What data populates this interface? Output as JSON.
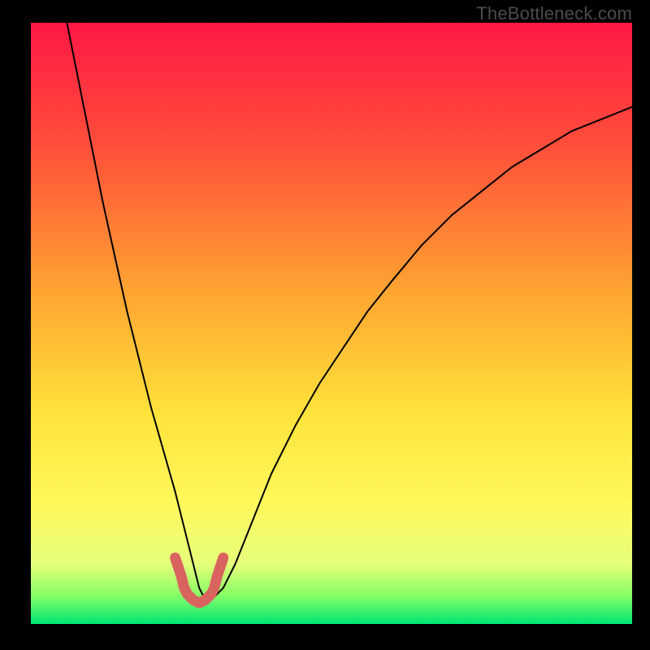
{
  "watermark": "TheBottleneck.com",
  "chart_data": {
    "type": "line",
    "title": "",
    "xlabel": "",
    "ylabel": "",
    "xlim": [
      0,
      100
    ],
    "ylim": [
      0,
      100
    ],
    "gradient_stops": [
      {
        "offset": 0,
        "color": "#ff1744"
      },
      {
        "offset": 20,
        "color": "#ff4d3a"
      },
      {
        "offset": 45,
        "color": "#ffa531"
      },
      {
        "offset": 65,
        "color": "#ffe33b"
      },
      {
        "offset": 80,
        "color": "#fff85c"
      },
      {
        "offset": 90,
        "color": "#e6ff7a"
      },
      {
        "offset": 95,
        "color": "#8cff66"
      },
      {
        "offset": 100,
        "color": "#00e676"
      }
    ],
    "series": [
      {
        "name": "curve",
        "color": "#000000",
        "stroke_width": 2,
        "x": [
          6,
          8,
          10,
          12,
          14,
          16,
          18,
          20,
          22,
          24,
          26,
          27,
          28,
          29,
          30,
          32,
          34,
          36,
          38,
          40,
          44,
          48,
          52,
          56,
          60,
          65,
          70,
          75,
          80,
          85,
          90,
          95,
          100
        ],
        "values": [
          100,
          90,
          80,
          70,
          61,
          52,
          44,
          36,
          29,
          22,
          14,
          10,
          6,
          4,
          4,
          6,
          10,
          15,
          20,
          25,
          33,
          40,
          46,
          52,
          57,
          63,
          68,
          72,
          76,
          79,
          82,
          84,
          86
        ]
      }
    ],
    "highlight": {
      "name": "minimum-marker",
      "color": "#d9645f",
      "stroke_width": 13,
      "linecap": "round",
      "x": [
        24,
        25,
        25.5,
        26,
        27,
        28,
        29,
        30,
        30.5,
        31,
        32
      ],
      "values": [
        11,
        8,
        6,
        5,
        4,
        3.5,
        4,
        5,
        6,
        8,
        11
      ]
    }
  }
}
